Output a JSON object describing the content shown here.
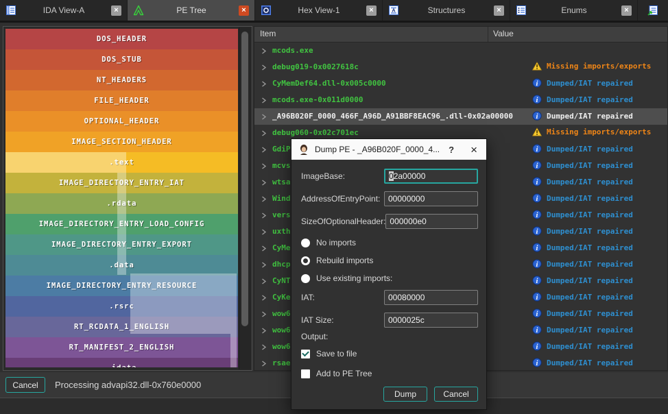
{
  "tab_bar": {
    "tabs": [
      {
        "label": "IDA View-A",
        "icon": "ida-view-icon",
        "active": false,
        "close": "gray"
      },
      {
        "label": "PE Tree",
        "icon": "pe-tree-icon",
        "active": true,
        "close": "red"
      },
      {
        "label": "Hex View-1",
        "icon": "hex-view-icon",
        "active": false,
        "close": "gray"
      },
      {
        "label": "Structures",
        "icon": "structures-icon",
        "active": false,
        "close": "gray"
      },
      {
        "label": "Enums",
        "icon": "enums-icon",
        "active": false,
        "close": "gray"
      }
    ],
    "partial_tab_icon": "imports-icon"
  },
  "pe_map": {
    "bands": [
      {
        "label": "DOS_HEADER",
        "color": "#b54545"
      },
      {
        "label": "DOS_STUB",
        "color": "#c55538"
      },
      {
        "label": "NT_HEADERS",
        "color": "#d2682f"
      },
      {
        "label": "FILE_HEADER",
        "color": "#e07e2b"
      },
      {
        "label": "OPTIONAL_HEADER",
        "color": "#ea9028"
      },
      {
        "label": "IMAGE_SECTION_HEADER",
        "color": "#f0a226"
      },
      {
        "label": ".text",
        "color": "#f5bc25"
      },
      {
        "label": "IMAGE_DIRECTORY_ENTRY_IAT",
        "color": "#c3b23c"
      },
      {
        "label": ".rdata",
        "color": "#8ea853"
      },
      {
        "label": "IMAGE_DIRECTORY_ENTRY_LOAD_CONFIG",
        "color": "#4fa06c"
      },
      {
        "label": "IMAGE_DIRECTORY_ENTRY_EXPORT",
        "color": "#4f9787"
      },
      {
        "label": ".data",
        "color": "#4e8b95"
      },
      {
        "label": "IMAGE_DIRECTORY_ENTRY_RESOURCE",
        "color": "#4c7ca4"
      },
      {
        "label": ".rsrc",
        "color": "#51669f"
      },
      {
        "label": "RT_RCDATA_1_ENGLISH",
        "color": "#68679a"
      },
      {
        "label": "RT_MANIFEST_2_ENGLISH",
        "color": "#7d5596"
      },
      {
        "label": ".idata",
        "color": "#693e77"
      }
    ]
  },
  "tree": {
    "columns": {
      "item": "Item",
      "value": "Value"
    },
    "rows": [
      {
        "item": "mcods.exe",
        "value_type": "none",
        "value": "",
        "selected": false
      },
      {
        "item": "debug019-0x0027618c",
        "value_type": "missing",
        "value": "Missing imports/exports",
        "selected": false
      },
      {
        "item": "CyMemDef64.dll-0x005c0000",
        "value_type": "dumped",
        "value": "Dumped/IAT repaired",
        "selected": false
      },
      {
        "item": "mcods.exe-0x011d0000",
        "value_type": "dumped",
        "value": "Dumped/IAT repaired",
        "selected": false
      },
      {
        "item": "_A96B020F_0000_466F_A96D_A91BBF8EAC96_.dll-0x02a00000",
        "value_type": "dumped",
        "value": "Dumped/IAT repaired",
        "selected": true
      },
      {
        "item": "debug060-0x02c701ec",
        "value_type": "missing",
        "value": "Missing imports/exports",
        "selected": false
      },
      {
        "item": "GdiP",
        "value_type": "dumped",
        "value": "Dumped/IAT repaired",
        "selected": false
      },
      {
        "item": "mcvs",
        "value_type": "dumped",
        "value": "Dumped/IAT repaired",
        "selected": false
      },
      {
        "item": "wtsa",
        "value_type": "dumped",
        "value": "Dumped/IAT repaired",
        "selected": false
      },
      {
        "item": "Wind",
        "value_type": "dumped",
        "value": "Dumped/IAT repaired",
        "selected": false
      },
      {
        "item": "vers",
        "value_type": "dumped",
        "value": "Dumped/IAT repaired",
        "selected": false
      },
      {
        "item": "uxth",
        "value_type": "dumped",
        "value": "Dumped/IAT repaired",
        "selected": false
      },
      {
        "item": "CyMe",
        "value_type": "dumped",
        "value": "Dumped/IAT repaired",
        "selected": false
      },
      {
        "item": "dhcp",
        "value_type": "dumped",
        "value": "Dumped/IAT repaired",
        "selected": false
      },
      {
        "item": "CyNT",
        "value_type": "dumped",
        "value": "Dumped/IAT repaired",
        "selected": false
      },
      {
        "item": "CyKe",
        "value_type": "dumped",
        "value": "Dumped/IAT repaired",
        "selected": false
      },
      {
        "item": "wow6",
        "value_type": "dumped",
        "value": "Dumped/IAT repaired",
        "selected": false
      },
      {
        "item": "wow6",
        "value_type": "dumped",
        "value": "Dumped/IAT repaired",
        "selected": false
      },
      {
        "item": "wow6",
        "value_type": "dumped",
        "value": "Dumped/IAT repaired",
        "selected": false
      },
      {
        "item": "rsae",
        "value_type": "dumped",
        "value": "Dumped/IAT repaired",
        "selected": false
      }
    ]
  },
  "dialog": {
    "title": "Dump PE - _A96B020F_0000_4...",
    "title_icon": "pe-tree-logo",
    "help_button": "?",
    "close_button": "×",
    "form": [
      {
        "type": "field",
        "label": "ImageBase:",
        "value": "02a00000",
        "focused": true,
        "selection_prefix": "0",
        "value_rest": "2a00000"
      },
      {
        "type": "field",
        "label": "AddressOfEntryPoint:",
        "value": "00000000",
        "focused": false
      },
      {
        "type": "field",
        "label": "SizeOfOptionalHeader:",
        "value": "000000e0",
        "focused": false
      },
      {
        "type": "radio",
        "label": "No imports",
        "selected": false
      },
      {
        "type": "radio",
        "label": "Rebuild imports",
        "selected": true
      },
      {
        "type": "radio",
        "label": "Use existing imports:",
        "selected": false
      },
      {
        "type": "field",
        "label": "IAT:",
        "value": "00080000",
        "focused": false
      },
      {
        "type": "field",
        "label": "IAT Size:",
        "value": "0000025c",
        "focused": false
      },
      {
        "type": "label",
        "label": "Output:"
      },
      {
        "type": "checkbox",
        "label": "Save to file",
        "checked": true
      },
      {
        "type": "checkbox",
        "label": "Add to PE Tree",
        "checked": false
      }
    ],
    "buttons": [
      {
        "label": "Dump"
      },
      {
        "label": "Cancel"
      }
    ]
  },
  "status_bar": {
    "cancel_label": "Cancel",
    "message": "Processing advapi32.dll-0x760e0000"
  },
  "colors": {
    "accent_teal": "#27a7a0",
    "item_green": "#41c341",
    "value_blue": "#2e8fd0",
    "warning_orange": "#ee8517",
    "selected_row": "#4e4e4e"
  }
}
